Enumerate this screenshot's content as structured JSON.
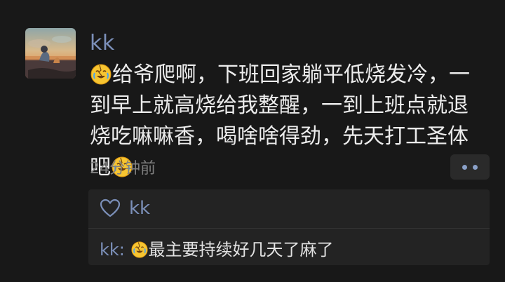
{
  "post": {
    "username": "kk",
    "text_before": "给爷爬啊，下班回家躺平低烧发冷，一到早上就高烧给我整醒，一到上班点就退烧吃嘛嘛香，喝啥啥得劲，先天打工圣体吧",
    "emoji_name": "crying-laughing-emoji",
    "timestamp": "24分钟前"
  },
  "likes": {
    "names": "kk"
  },
  "comments": [
    {
      "author": "kk:",
      "text": "最主要持续好几天了麻了"
    }
  ]
}
